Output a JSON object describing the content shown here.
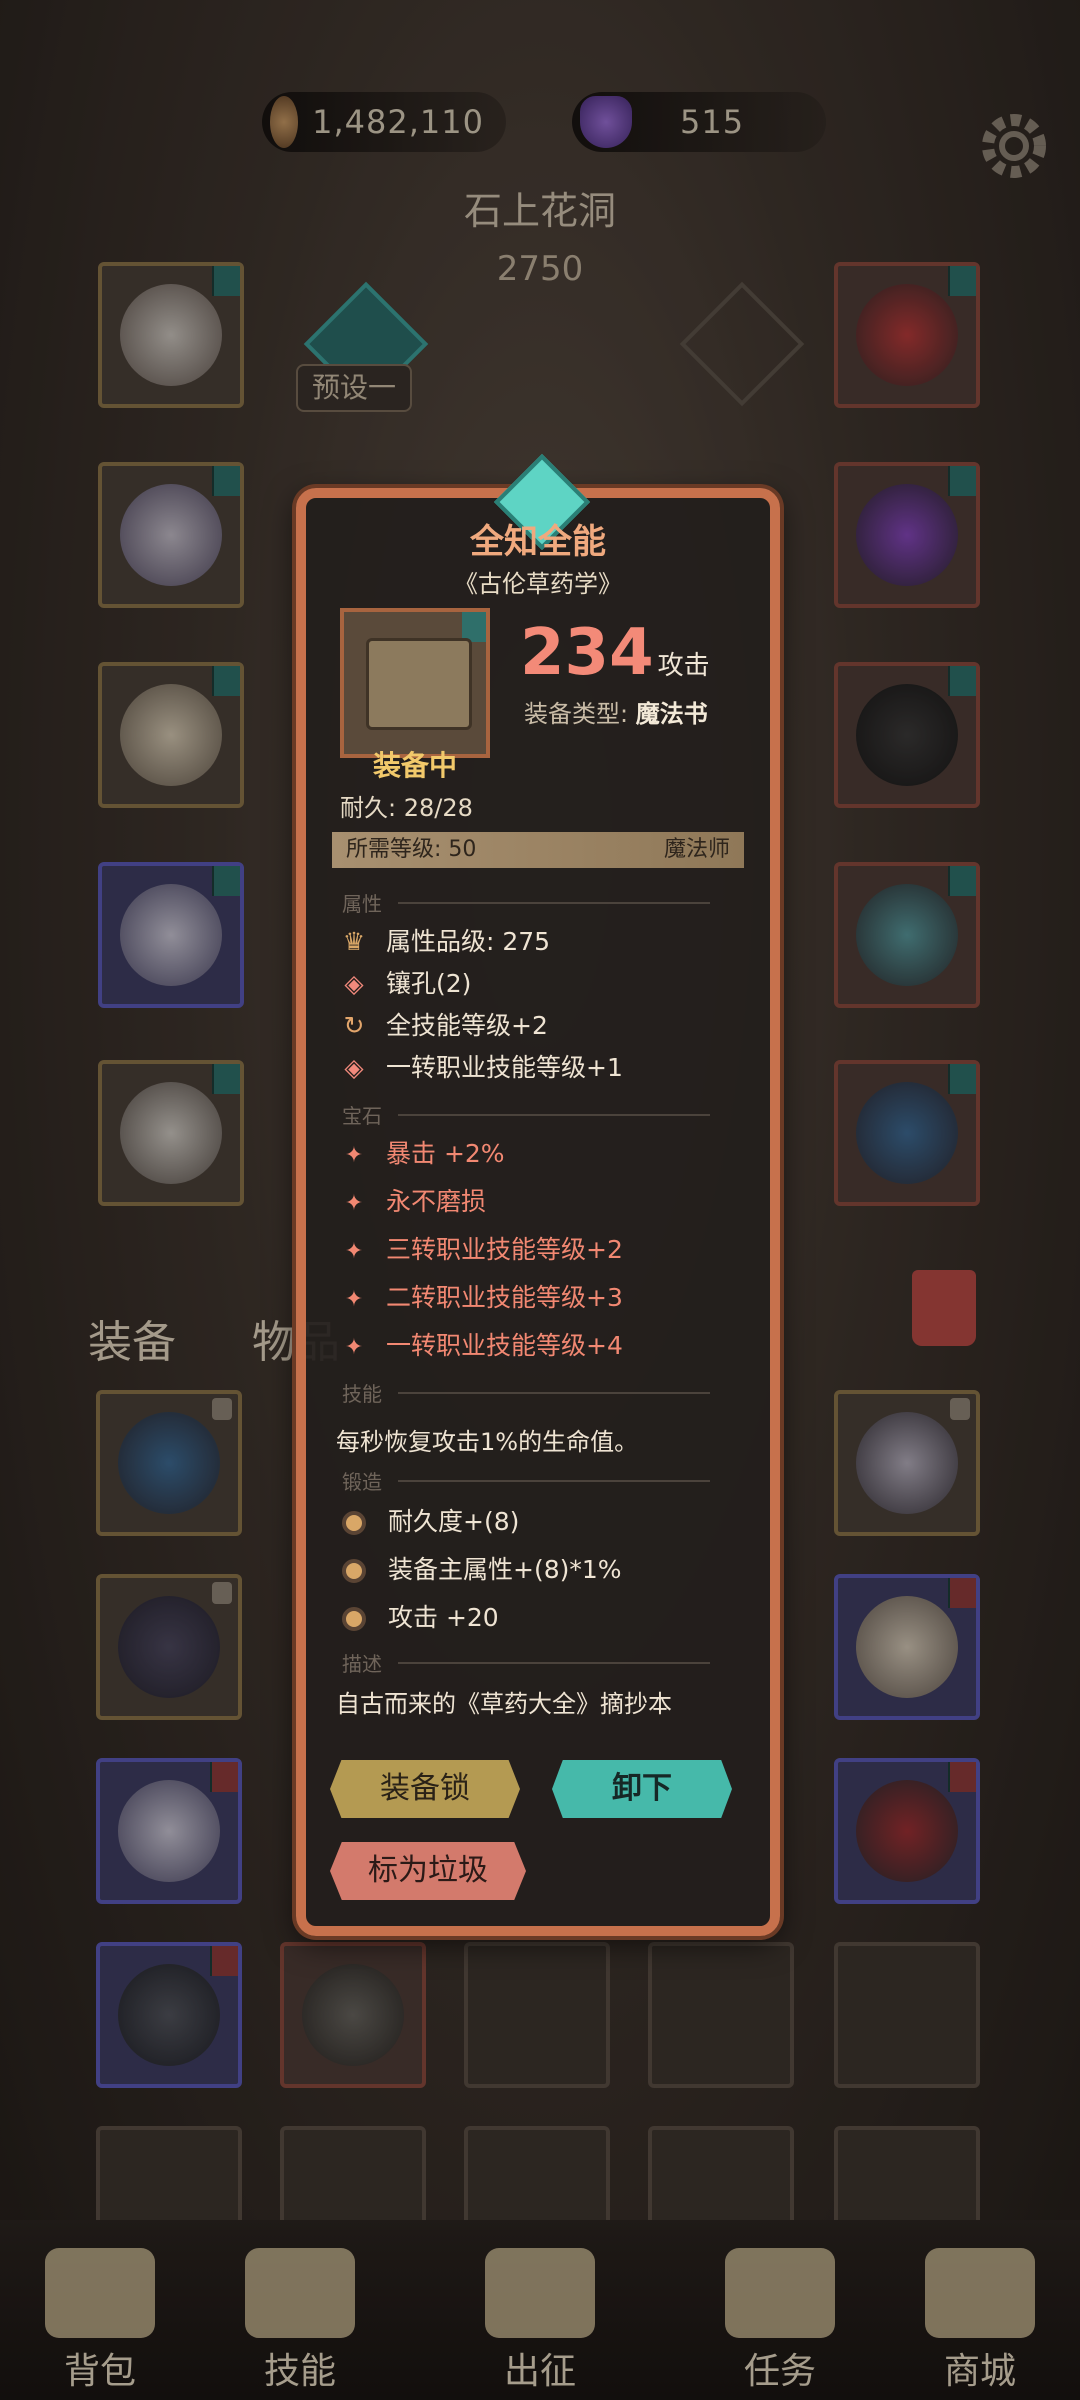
{
  "header": {
    "gold": "1,482,110",
    "gems": "515",
    "area_name": "石上花洞",
    "power": "2750",
    "preset_label": "预设一"
  },
  "bag": {
    "tab_equip": "装备",
    "tab_items": "物品"
  },
  "nav": [
    {
      "label": "背包"
    },
    {
      "label": "技能"
    },
    {
      "label": "出征"
    },
    {
      "label": "任务"
    },
    {
      "label": "商城"
    }
  ],
  "popup": {
    "title": "全知全能",
    "subtitle": "《古伦草药学》",
    "equipped_label": "装备中",
    "attack_value": "234",
    "attack_label": "攻击",
    "type_key": "装备类型:",
    "type_value": "魔法书",
    "durability": "耐久: 28/28",
    "required_level": "所需等级: 50",
    "class": "魔法师",
    "sections": {
      "attributes": "属性",
      "gems": "宝石",
      "skill": "技能",
      "forge": "锻造",
      "desc": "描述"
    },
    "attributes": [
      "属性品级: 275",
      "镶孔(2)",
      "全技能等级+2",
      "一转职业技能等级+1"
    ],
    "gems": [
      "暴击 +2%",
      "永不磨损",
      "三转职业技能等级+2",
      "二转职业技能等级+3",
      "一转职业技能等级+4"
    ],
    "skill_text": "每秒恢复攻击1%的生命值。",
    "forge": [
      "耐久度+(8)",
      "装备主属性+(8)*1%",
      "攻击 +20"
    ],
    "description": "自古而来的《草药大全》摘抄本",
    "btn_lock": "装备锁",
    "btn_unequip": "卸下",
    "btn_trash": "标为垃圾"
  },
  "colors": {
    "accent_red": "#f38a78",
    "frame": "#c7714c",
    "teal": "#46b9aa",
    "gold": "#f2c96b"
  }
}
